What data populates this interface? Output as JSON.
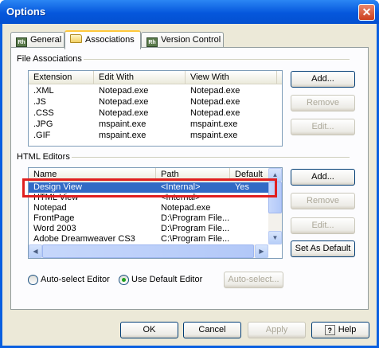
{
  "window": {
    "title": "Options",
    "close_glyph": "✕"
  },
  "tabs": [
    {
      "label": "General",
      "icon": "rh-icon"
    },
    {
      "label": "Associations",
      "icon": "folder-icon"
    },
    {
      "label": "Version Control",
      "icon": "rh-icon"
    }
  ],
  "tab_icon_text": "Rh",
  "file_assoc": {
    "label": "File Associations",
    "columns": [
      "Extension",
      "Edit With",
      "View With"
    ],
    "rows": [
      [
        ".XML",
        "Notepad.exe",
        "Notepad.exe"
      ],
      [
        ".JS",
        "Notepad.exe",
        "Notepad.exe"
      ],
      [
        ".CSS",
        "Notepad.exe",
        "Notepad.exe"
      ],
      [
        ".JPG",
        "mspaint.exe",
        "mspaint.exe"
      ],
      [
        ".GIF",
        "mspaint.exe",
        "mspaint.exe"
      ]
    ],
    "buttons": {
      "add": "Add...",
      "remove": "Remove",
      "edit": "Edit..."
    }
  },
  "html_editors": {
    "label": "HTML Editors",
    "columns": [
      "Name",
      "Path",
      "Default"
    ],
    "rows": [
      [
        "Design View",
        "<Internal>",
        "Yes"
      ],
      [
        "HTML View",
        "<Internal>",
        ""
      ],
      [
        "Notepad",
        "Notepad.exe",
        ""
      ],
      [
        "FrontPage",
        "D:\\Program File...",
        ""
      ],
      [
        "Word 2003",
        "D:\\Program File...",
        ""
      ],
      [
        "Adobe Dreamweaver CS3",
        "C:\\Program File...",
        ""
      ]
    ],
    "selected_row": "Design View",
    "buttons": {
      "add": "Add...",
      "remove": "Remove",
      "edit": "Edit...",
      "set_default": "Set As Default"
    }
  },
  "options": {
    "auto_select_editor": "Auto-select Editor",
    "use_default_editor": "Use Default Editor",
    "selected": "Use Default Editor",
    "auto_select_button": "Auto-select..."
  },
  "footer": {
    "ok": "OK",
    "cancel": "Cancel",
    "apply": "Apply",
    "help": "Help",
    "help_icon": "?"
  },
  "colors": {
    "titlebar": "#0557dc",
    "selection": "#316ac5",
    "highlight_box": "#e01f1f"
  }
}
